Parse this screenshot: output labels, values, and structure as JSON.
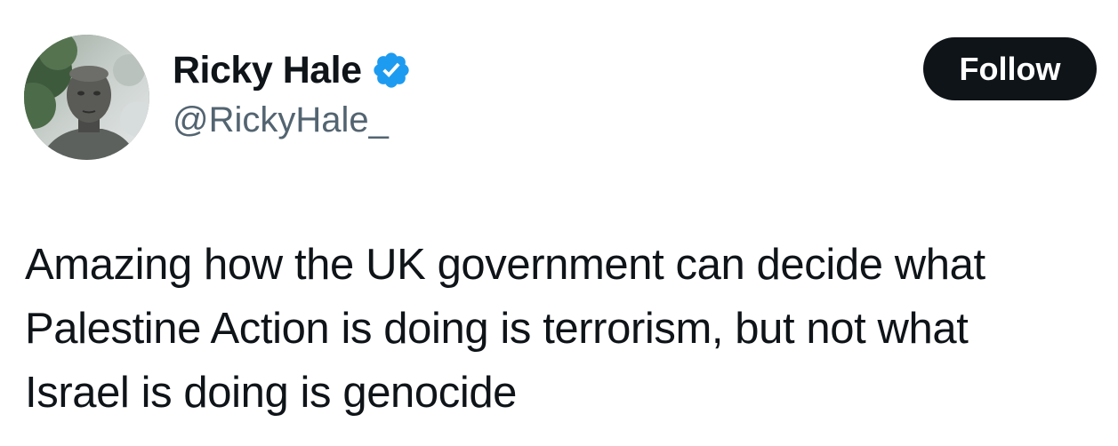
{
  "tweet": {
    "author": {
      "display_name": "Ricky Hale",
      "handle": "@RickyHale_",
      "verified_icon": "verified-badge-icon",
      "avatar_icon": "profile-avatar"
    },
    "follow_button": {
      "label": "Follow"
    },
    "text_lines": [
      "Amazing how the UK government can decide what",
      "Palestine Action is doing is terrorism, but not what",
      "Israel is doing is genocide"
    ]
  },
  "colors": {
    "text_primary": "#0f1419",
    "text_secondary": "#536471",
    "verified_blue": "#1d9bf0",
    "follow_bg": "#0f1419",
    "follow_text": "#ffffff",
    "background": "#ffffff"
  }
}
